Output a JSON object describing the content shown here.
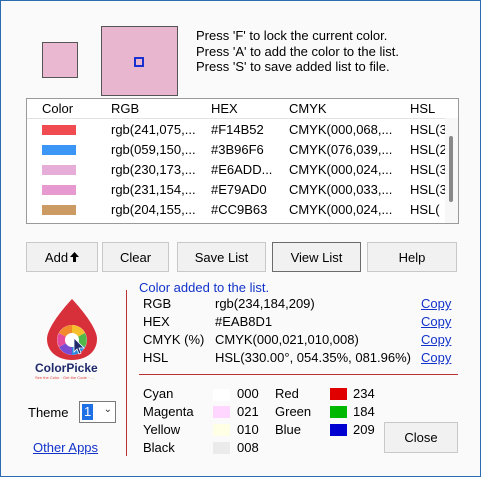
{
  "instructions": [
    "Press 'F' to lock the current color.",
    "Press 'A' to add the color to the list.",
    "Press 'S' to save added list to file."
  ],
  "preview": {
    "locked_color": "#EAB8D1",
    "magnifier_color": "#E8B6CF"
  },
  "list": {
    "headers": [
      "Color",
      "RGB",
      "HEX",
      "CMYK",
      "HSL"
    ],
    "rows": [
      {
        "color": "#F14B52",
        "rgb": "rgb(241,075,...",
        "hex": "#F14B52",
        "cmyk": "CMYK(000,068,...",
        "hsl": "HSL(3"
      },
      {
        "color": "#3B96F6",
        "rgb": "rgb(059,150,...",
        "hex": "#3B96F6",
        "cmyk": "CMYK(076,039,...",
        "hsl": "HSL(2"
      },
      {
        "color": "#E6ADD8",
        "rgb": "rgb(230,173,...",
        "hex": "#E6ADD...",
        "cmyk": "CMYK(000,024,...",
        "hsl": "HSL(3"
      },
      {
        "color": "#E79AD0",
        "rgb": "rgb(231,154,...",
        "hex": "#E79AD0",
        "cmyk": "CMYK(000,033,...",
        "hsl": "HSL(3"
      },
      {
        "color": "#CC9B63",
        "rgb": "rgb(204,155,...",
        "hex": "#CC9B63",
        "cmyk": "CMYK(000,024,...",
        "hsl": "HSL("
      }
    ]
  },
  "buttons": {
    "add": "Add",
    "clear": "Clear",
    "save_list": "Save List",
    "view_list": "View List",
    "help": "Help",
    "close": "Close"
  },
  "logo": {
    "name": "ColorPicke",
    "tagline": "See the Color · Get the Code · ..."
  },
  "theme": {
    "label": "Theme",
    "value": "1"
  },
  "other_apps": "Other Apps",
  "status": "Color added to the list.",
  "values": {
    "rgb_label": "RGB",
    "rgb": "rgb(234,184,209)",
    "hex_label": "HEX",
    "hex": "#EAB8D1",
    "cmyk_label": "CMYK (%)",
    "cmyk": "CMYK(000,021,010,008)",
    "hsl_label": "HSL",
    "hsl": "HSL(330.00°, 054.35%, 081.96%)",
    "copy": "Copy"
  },
  "components": {
    "cyan_label": "Cyan",
    "cyan": "000",
    "cyan_color": "#ffffff",
    "magenta_label": "Magenta",
    "magenta": "021",
    "magenta_color": "#ffd6ff",
    "yellow_label": "Yellow",
    "yellow": "010",
    "yellow_color": "#ffffe6",
    "black_label": "Black",
    "black": "008",
    "black_color": "#ebebeb",
    "red_label": "Red",
    "red": "234",
    "red_color": "#e00000",
    "green_label": "Green",
    "green": "184",
    "green_color": "#00b800",
    "blue_label": "Blue",
    "blue": "209",
    "blue_color": "#0000d1"
  }
}
